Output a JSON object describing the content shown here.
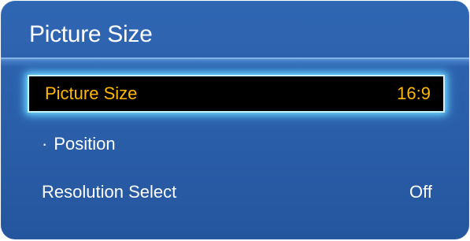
{
  "menu": {
    "title": "Picture Size",
    "items": [
      {
        "label": "Picture Size",
        "value": "16:9",
        "selected": true
      },
      {
        "label": "Position",
        "value": "",
        "prefix": "·"
      },
      {
        "label": "Resolution Select",
        "value": "Off"
      }
    ]
  },
  "colors": {
    "panel_background": "#2a5ea8",
    "selected_background": "#000000",
    "selected_text": "#ffb800",
    "selected_glow": "#6fd7ff",
    "text": "#ffffff"
  }
}
